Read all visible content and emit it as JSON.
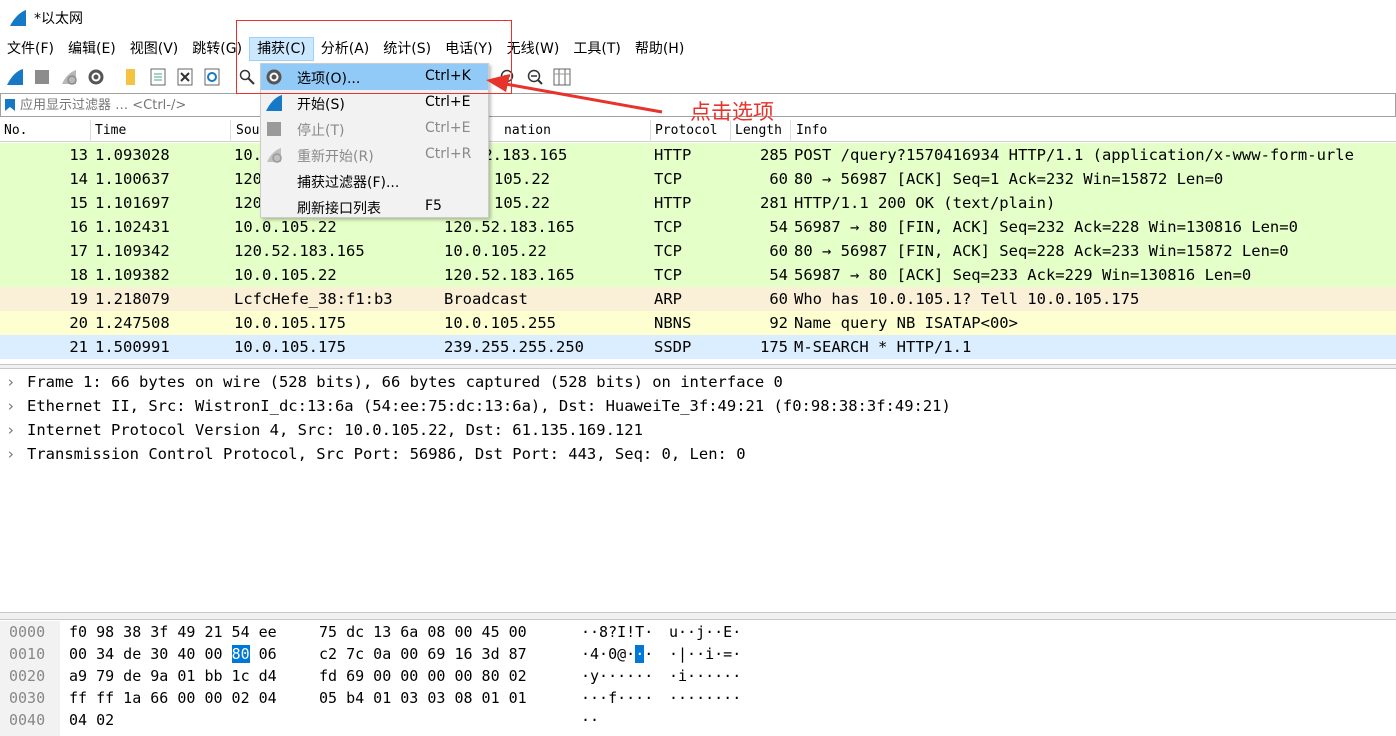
{
  "window": {
    "title": "*以太网"
  },
  "menubar": [
    "文件(F)",
    "编辑(E)",
    "视图(V)",
    "跳转(G)",
    "捕获(C)",
    "分析(A)",
    "统计(S)",
    "电话(Y)",
    "无线(W)",
    "工具(T)",
    "帮助(H)"
  ],
  "filter": {
    "placeholder": "应用显示过滤器 … <Ctrl-/>"
  },
  "columns": {
    "no": "No.",
    "time": "Time",
    "source": "Sou",
    "destination": "nation",
    "protocol": "Protocol",
    "length": "Length",
    "info": "Info"
  },
  "packets": [
    {
      "no": "13",
      "time": "1.093028",
      "src": "10.",
      "dst": "52.183.165",
      "proto": "HTTP",
      "len": "285",
      "info": "POST /query?1570416934 HTTP/1.1  (application/x-www-form-urle",
      "color": "#e4ffc7"
    },
    {
      "no": "14",
      "time": "1.100637",
      "src": "120",
      "dst": "105.22",
      "proto": "TCP",
      "len": "60",
      "info": "80 → 56987 [ACK] Seq=1 Ack=232 Win=15872 Len=0",
      "color": "#e4ffc7"
    },
    {
      "no": "15",
      "time": "1.101697",
      "src": "120",
      "dst": "105.22",
      "proto": "HTTP",
      "len": "281",
      "info": "HTTP/1.1 200 OK  (text/plain)",
      "color": "#e4ffc7"
    },
    {
      "no": "16",
      "time": "1.102431",
      "src": "10.0.105.22",
      "dst": "120.52.183.165",
      "proto": "TCP",
      "len": "54",
      "info": "56987 → 80 [FIN, ACK] Seq=232 Ack=228 Win=130816 Len=0",
      "color": "#e4ffc7"
    },
    {
      "no": "17",
      "time": "1.109342",
      "src": "120.52.183.165",
      "dst": "10.0.105.22",
      "proto": "TCP",
      "len": "60",
      "info": "80 → 56987 [FIN, ACK] Seq=228 Ack=233 Win=15872 Len=0",
      "color": "#e4ffc7"
    },
    {
      "no": "18",
      "time": "1.109382",
      "src": "10.0.105.22",
      "dst": "120.52.183.165",
      "proto": "TCP",
      "len": "54",
      "info": "56987 → 80 [ACK] Seq=233 Ack=229 Win=130816 Len=0",
      "color": "#e4ffc7"
    },
    {
      "no": "19",
      "time": "1.218079",
      "src": "LcfcHefe_38:f1:b3",
      "dst": "Broadcast",
      "proto": "ARP",
      "len": "60",
      "info": "Who has 10.0.105.1? Tell 10.0.105.175",
      "color": "#faf0d7"
    },
    {
      "no": "20",
      "time": "1.247508",
      "src": "10.0.105.175",
      "dst": "10.0.105.255",
      "proto": "NBNS",
      "len": "92",
      "info": "Name query NB ISATAP<00>",
      "color": "#feffd0"
    },
    {
      "no": "21",
      "time": "1.500991",
      "src": "10.0.105.175",
      "dst": "239.255.255.250",
      "proto": "SSDP",
      "len": "175",
      "info": "M-SEARCH * HTTP/1.1",
      "color": "#daeeff"
    }
  ],
  "details": [
    "Frame 1: 66 bytes on wire (528 bits), 66 bytes captured (528 bits) on interface 0",
    "Ethernet II, Src: WistronI_dc:13:6a (54:ee:75:dc:13:6a), Dst: HuaweiTe_3f:49:21 (f0:98:38:3f:49:21)",
    "Internet Protocol Version 4, Src: 10.0.105.22, Dst: 61.135.169.121",
    "Transmission Control Protocol, Src Port: 56986, Dst Port: 443, Seq: 0, Len: 0"
  ],
  "hex": [
    {
      "off": "0000",
      "b1": "f0 98 38 3f 49 21 54 ee",
      "b2": "75 dc 13 6a 08 00 45 00",
      "a1": "··8?I!T·",
      "a2": "u··j··E·"
    },
    {
      "off": "0010",
      "b1a": "00 34 de 30 40 00 ",
      "b1h": "80",
      "b1b": " 06",
      "b2": "c2 7c 0a 00 69 16 3d 87",
      "a1a": "·4·0@·",
      "a1h": "·",
      "a1b": "·",
      "a2": "·|··i·=·"
    },
    {
      "off": "0020",
      "b1": "a9 79 de 9a 01 bb 1c d4",
      "b2": "fd 69 00 00 00 00 80 02",
      "a1": "·y······",
      "a2": "·i······"
    },
    {
      "off": "0030",
      "b1": "ff ff 1a 66 00 00 02 04",
      "b2": "05 b4 01 03 03 08 01 01",
      "a1": "···f····",
      "a2": "········"
    },
    {
      "off": "0040",
      "b1": "04 02",
      "b2": "",
      "a1": "··",
      "a2": ""
    }
  ],
  "capture_menu": [
    {
      "icon": "gear-icon",
      "label": "选项(O)...",
      "shortcut": "Ctrl+K"
    },
    {
      "icon": "shark-fin-icon",
      "label": "开始(S)",
      "shortcut": "Ctrl+E"
    },
    {
      "icon": "stop-icon",
      "label": "停止(T)",
      "shortcut": "Ctrl+E"
    },
    {
      "icon": "restart-icon",
      "label": "重新开始(R)",
      "shortcut": "Ctrl+R"
    },
    {
      "icon": "",
      "label": "捕获过滤器(F)...",
      "shortcut": ""
    },
    {
      "icon": "",
      "label": "刷新接口列表",
      "shortcut": "F5"
    }
  ],
  "annotation": {
    "text": "点击选项",
    "color": "#e8322c"
  }
}
